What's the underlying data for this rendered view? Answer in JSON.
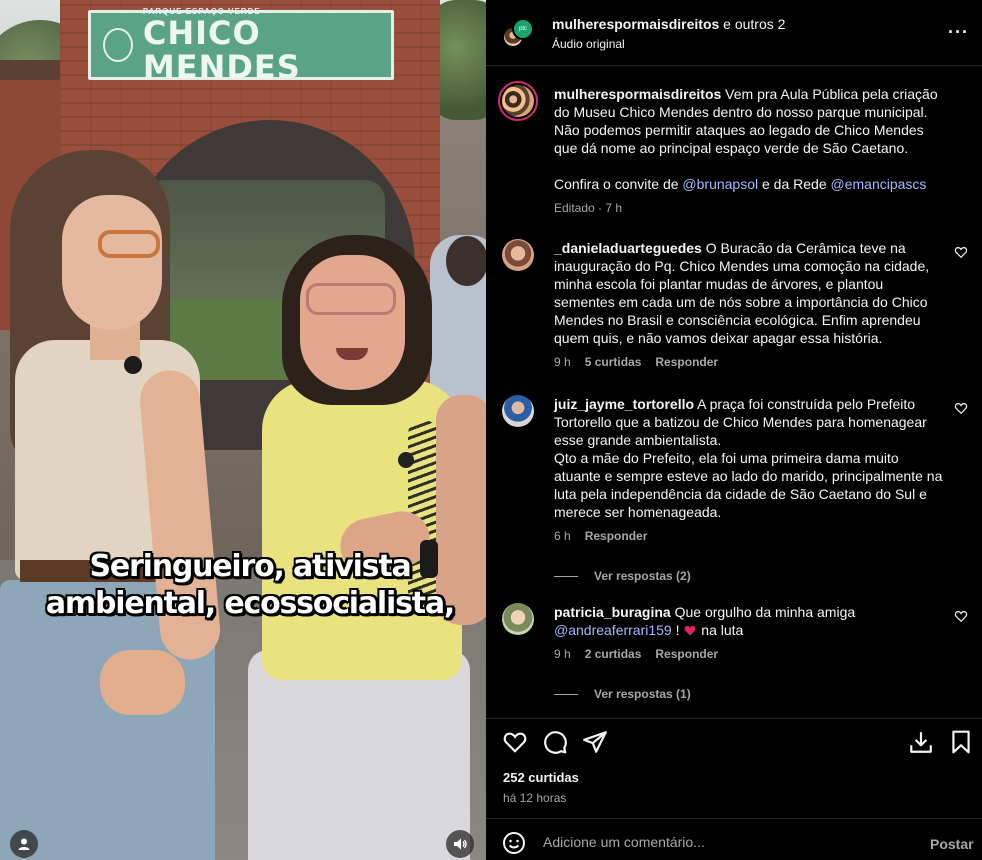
{
  "media": {
    "sign_small": "PARQUE ESPAÇO VERDE",
    "sign_big": "CHICO MENDES",
    "caption_line1": "Seringueiro, ativista",
    "caption_line2": "ambiental, ecossocialista,"
  },
  "header": {
    "username": "mulherespormaisdireitos",
    "others": " e outros 2",
    "audio": "Áudio original",
    "more": "···",
    "avatar_badge": "ptc"
  },
  "post": {
    "username": "mulherespormaisdireitos",
    "text": "Vem pra Aula Pública pela criação do Museu Chico Mendes dentro do nosso parque municipal. Não podemos permitir ataques ao legado de Chico Mendes que dá nome ao principal espaço verde de São Caetano.",
    "invite_prefix": "Confira o convite de ",
    "mention1": "@brunapsol",
    "invite_mid": " e da Rede ",
    "mention2": "@emancipascs",
    "meta": "Editado · 7 h"
  },
  "comments": [
    {
      "username": "_danieladuarteguedes",
      "text": "O Buracão da Cerâmica teve na inauguração do Pq. Chico Mendes uma comoção na cidade, minha escola foi plantar mudas de árvores, e plantou sementes em cada um de nós sobre a importância do Chico Mendes no Brasil e consciência ecológica. Enfim aprendeu quem quis, e não vamos deixar apagar essa história.",
      "time": "9 h",
      "likes": "5 curtidas",
      "reply": "Responder"
    },
    {
      "username": "juiz_jayme_tortorello",
      "text": "A praça foi construída pelo Prefeito Tortorello que a batizou de Chico Mendes para homenagear esse grande ambientalista.",
      "text2": "Qto a mãe do Prefeito, ela foi uma primeira dama muito atuante e sempre esteve ao lado do marido, principalmente na luta pela independência da cidade de São Caetano do Sul e merece ser homenageada.",
      "time": "6 h",
      "reply": "Responder",
      "view_replies": "Ver respostas (2)"
    },
    {
      "username": "patricia_buragina",
      "text": "Que orgulho da minha amiga",
      "mention": "@andreaferrari159",
      "text_after": " ! ",
      "text_end": " na luta",
      "time": "9 h",
      "likes": "2 curtidas",
      "reply": "Responder",
      "view_replies": "Ver respostas (1)"
    }
  ],
  "footer": {
    "likes": "252 curtidas",
    "time": "há 12 horas",
    "comment_placeholder": "Adicione um comentário...",
    "post_label": "Postar"
  }
}
